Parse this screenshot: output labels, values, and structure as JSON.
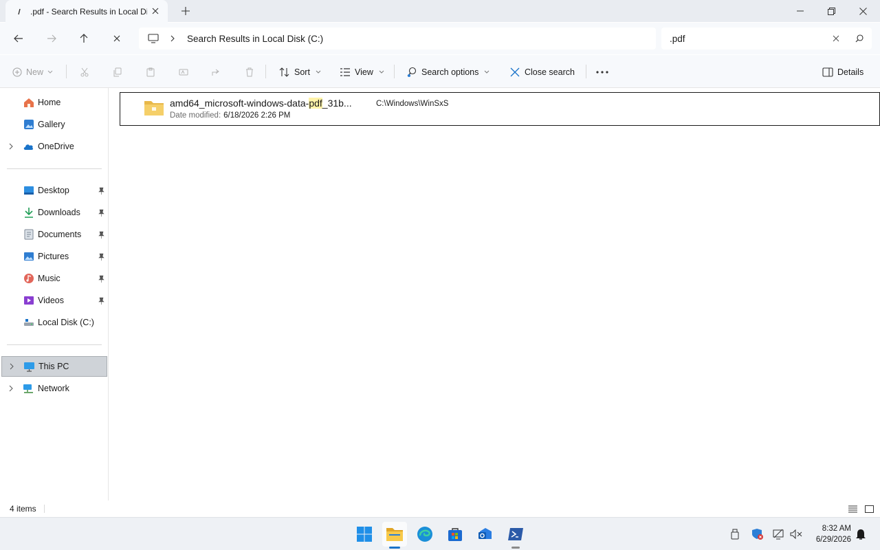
{
  "tab": {
    "title": ".pdf - Search Results in Local Disk (C:)",
    "icon": "search-icon"
  },
  "address": {
    "crumb": "Search Results in Local Disk (C:)"
  },
  "search": {
    "value": ".pdf"
  },
  "commands": {
    "new": "New",
    "sort": "Sort",
    "view": "View",
    "search_options": "Search options",
    "close_search": "Close search",
    "details": "Details"
  },
  "sidebar": {
    "items": [
      {
        "label": "Home",
        "icon": "home-icon"
      },
      {
        "label": "Gallery",
        "icon": "gallery-icon"
      },
      {
        "label": "OneDrive",
        "icon": "onedrive-icon"
      },
      {
        "label": "Desktop",
        "icon": "desktop-icon"
      },
      {
        "label": "Downloads",
        "icon": "downloads-icon"
      },
      {
        "label": "Documents",
        "icon": "documents-icon"
      },
      {
        "label": "Pictures",
        "icon": "pictures-icon"
      },
      {
        "label": "Music",
        "icon": "music-icon"
      },
      {
        "label": "Videos",
        "icon": "videos-icon"
      },
      {
        "label": "Local Disk (C:)",
        "icon": "drive-icon"
      },
      {
        "label": "This PC",
        "icon": "this-pc-icon"
      },
      {
        "label": "Network",
        "icon": "network-icon"
      }
    ]
  },
  "results": [
    {
      "name_pre": "amd64_microsoft-windows-data-",
      "name_match": "pdf",
      "name_post": "_31b...",
      "modified_label": "Date modified:",
      "modified_value": "6/18/2026 2:26 PM",
      "path": "C:\\Windows\\WinSxS"
    }
  ],
  "status": {
    "count": "4 items"
  },
  "clock": {
    "time": "8:32 AM",
    "date": "6/29/2026"
  },
  "colors": {
    "accent": "#1a73c9",
    "highlight": "#fff3a8",
    "selected": "#cfd3d8"
  }
}
